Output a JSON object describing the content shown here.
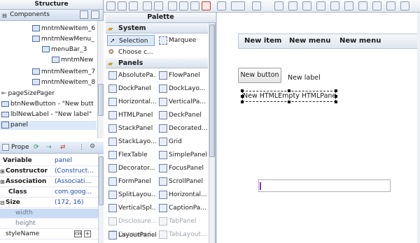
{
  "structure": {
    "title": "Structure",
    "header_label": "Components",
    "items": [
      {
        "label": "mntmNewItem_6"
      },
      {
        "label": "mntmNewMenu_"
      },
      {
        "label": "menuBar_3"
      },
      {
        "label": "mntmNew"
      },
      {
        "label": "mntmNewItem_7"
      },
      {
        "label": "mntmNewItem_8"
      },
      {
        "label": "pageSizePager"
      },
      {
        "label": "btnNewButton - \"New butt"
      },
      {
        "label": "lblNewLabel - \"New label\""
      },
      {
        "label": "panel"
      }
    ]
  },
  "properties": {
    "header_label": "Prope",
    "rows": [
      {
        "key": "Variable",
        "value": "panel"
      },
      {
        "key": "Constructor",
        "value": "(Construct..."
      },
      {
        "key": "Association",
        "value": "(Associati..."
      },
      {
        "key": "Class",
        "value": "com.goog..."
      },
      {
        "key": "Size",
        "value": "(172, 16)"
      },
      {
        "key": "width",
        "value": ""
      },
      {
        "key": "height",
        "value": ""
      },
      {
        "key": "styleName",
        "value": ""
      }
    ]
  },
  "palette": {
    "title": "Palette",
    "system_label": "System",
    "selection_label": "Selection",
    "marquee_label": "Marquee",
    "choose_label": "Choose c...",
    "panels_label": "Panels",
    "left_items": [
      "AbsolutePa...",
      "DockPanel",
      "Horizontal...",
      "HTMLPanel",
      "StackPanel",
      "StackLayo...",
      "FlexTable",
      "Decorator...",
      "FormPanel",
      "SplitLayou...",
      "VerticalSpl...",
      "Disclosure...",
      "Decorated...",
      "LayoutPanel"
    ],
    "right_items": [
      "FlowPanel",
      "DockLayo...",
      "VerticalPa...",
      "DeckPanel",
      "Decorated...",
      "Grid",
      "SimplePanel",
      "FocusPanel",
      "ScrollPanel",
      "Horizontal...",
      "CaptionPa...",
      "TabPanel",
      "TabLayout..."
    ]
  },
  "canvas": {
    "menu_items": [
      "New item",
      "New menu",
      "New menu"
    ],
    "button_label": "New button",
    "label_text": "New label",
    "html_text": "New HTMLEmpty HTMLPanel"
  },
  "colors": {
    "accent": "#1f4aa8",
    "panel_border": "#9aa9bf",
    "caret": "#8a2be2"
  }
}
